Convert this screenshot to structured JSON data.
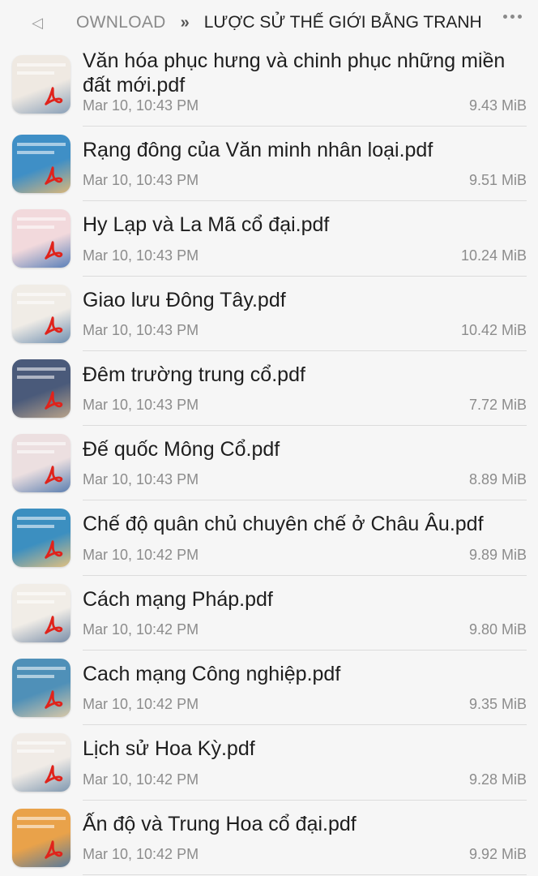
{
  "header": {
    "back_icon": "back-arrow-icon",
    "parent_folder": "OWNLOAD",
    "separator": "»",
    "current_folder": "LƯỢC SỬ THẾ GIỚI BẰNG TRANH",
    "more_icon": "more-options-icon"
  },
  "files": [
    {
      "name": "Văn hóa phục hưng và chinh phục những miền đất mới.pdf",
      "date": "Mar 10, 10:43 PM",
      "size": "9.43 MiB",
      "thumb_color": "#efe9e2",
      "thumb_accent": "#8aa0b8"
    },
    {
      "name": "Rạng đông của Văn minh nhân loại.pdf",
      "date": "Mar 10, 10:43 PM",
      "size": "9.51 MiB",
      "thumb_color": "#3f8fc6",
      "thumb_accent": "#d9b67a"
    },
    {
      "name": "Hy Lạp và La Mã cổ đại.pdf",
      "date": "Mar 10, 10:43 PM",
      "size": "10.24 MiB",
      "thumb_color": "#f2d9dc",
      "thumb_accent": "#5a7fb8"
    },
    {
      "name": "Giao lưu Đông Tây.pdf",
      "date": "Mar 10, 10:43 PM",
      "size": "10.42 MiB",
      "thumb_color": "#f0ece6",
      "thumb_accent": "#6f8fb0"
    },
    {
      "name": "Đêm trường trung cổ.pdf",
      "date": "Mar 10, 10:43 PM",
      "size": "7.72 MiB",
      "thumb_color": "#4a5a7a",
      "thumb_accent": "#b8a28a"
    },
    {
      "name": "Đế quốc Mông Cổ.pdf",
      "date": "Mar 10, 10:43 PM",
      "size": "8.89 MiB",
      "thumb_color": "#ecdfe0",
      "thumb_accent": "#5c7fb0"
    },
    {
      "name": "Chế độ quân chủ chuyên chế ở Châu Âu.pdf",
      "date": "Mar 10, 10:42 PM",
      "size": "9.89 MiB",
      "thumb_color": "#3c8fc0",
      "thumb_accent": "#e0c080"
    },
    {
      "name": "Cách mạng Pháp.pdf",
      "date": "Mar 10, 10:42 PM",
      "size": "9.80 MiB",
      "thumb_color": "#f1ede7",
      "thumb_accent": "#7a8ea8"
    },
    {
      "name": "Cach mạng Công nghiệp.pdf",
      "date": "Mar 10, 10:42 PM",
      "size": "9.35 MiB",
      "thumb_color": "#4f90b8",
      "thumb_accent": "#d8c8a8"
    },
    {
      "name": "Lịch sử Hoa Kỳ.pdf",
      "date": "Mar 10, 10:42 PM",
      "size": "9.28 MiB",
      "thumb_color": "#f0ebe6",
      "thumb_accent": "#8098b0"
    },
    {
      "name": "Ấn độ và Trung Hoa cổ đại.pdf",
      "date": "Mar 10, 10:42 PM",
      "size": "9.92 MiB",
      "thumb_color": "#e9a24a",
      "thumb_accent": "#5a7a9a"
    }
  ],
  "file_icon": "pdf-file-icon"
}
